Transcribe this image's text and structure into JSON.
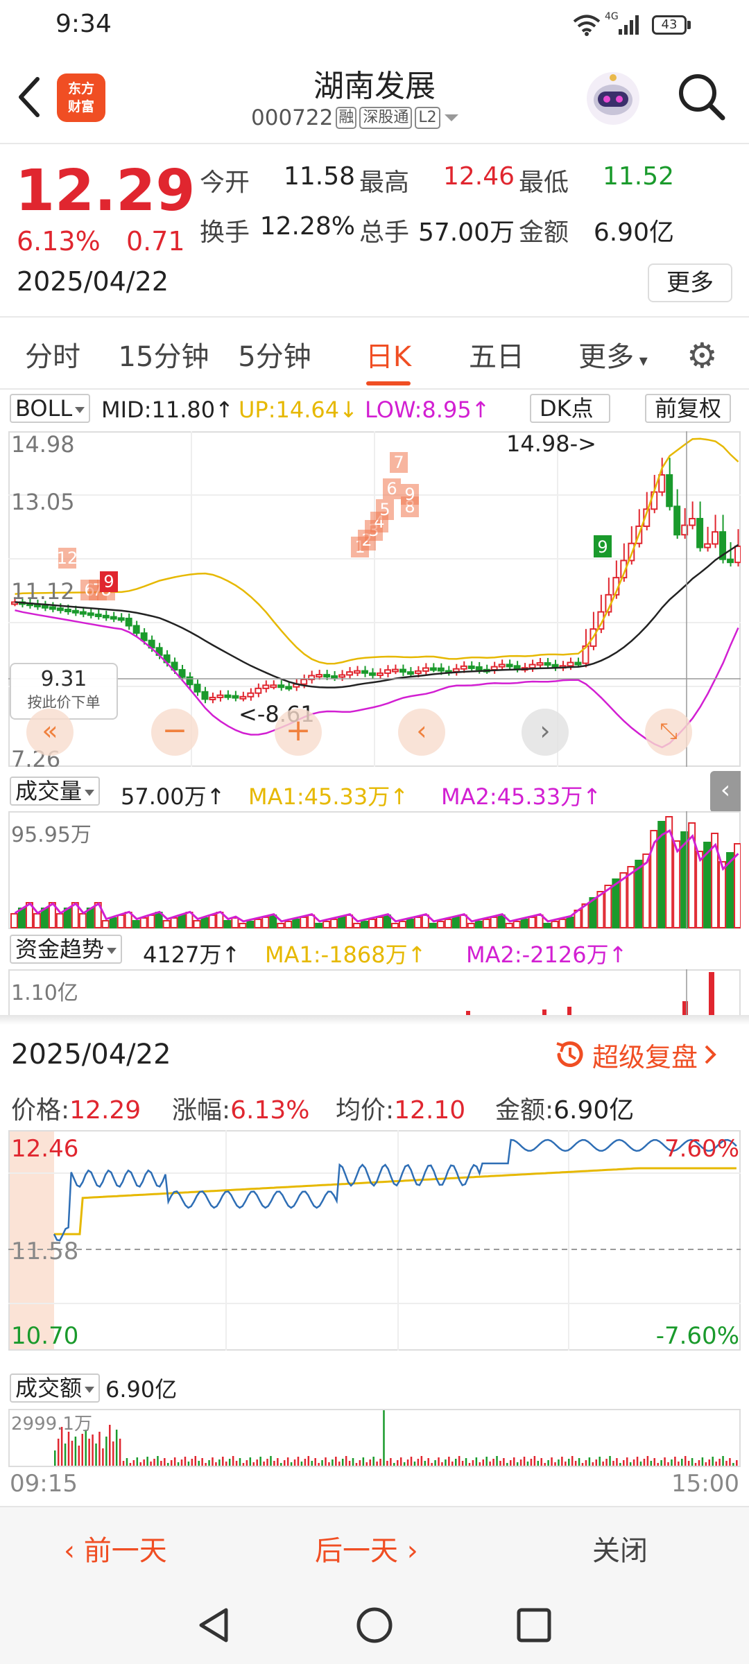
{
  "status": {
    "time": "9:34",
    "signal": "4G",
    "battery": "43"
  },
  "header": {
    "title": "湖南发展",
    "code": "000722",
    "badges": [
      "融",
      "深股通",
      "L2"
    ],
    "logo": [
      "东方",
      "财富"
    ]
  },
  "quote": {
    "price": "12.29",
    "pct": "6.13%",
    "chg": "0.71",
    "date": "2025/04/22",
    "stats": [
      {
        "label": "今开",
        "value": "11.58",
        "color": "#222"
      },
      {
        "label": "最高",
        "value": "12.46",
        "color": "#e0262f"
      },
      {
        "label": "最低",
        "value": "11.52",
        "color": "#1a9a2c"
      },
      {
        "label": "换手",
        "value": "12.28%",
        "color": "#222"
      },
      {
        "label": "总手",
        "value": "57.00万",
        "color": "#222"
      },
      {
        "label": "金额",
        "value": "6.90亿",
        "color": "#222"
      }
    ],
    "more": "更多"
  },
  "tabs": [
    "分时",
    "15分钟",
    "5分钟",
    "日K",
    "五日",
    "更多"
  ],
  "active_tab": "日K",
  "kchart": {
    "indicator": "BOLL",
    "mid": "MID:11.80↑",
    "up": "UP:14.64↓",
    "low": "LOW:8.95↑",
    "dk": "DK点",
    "fq": "前复权",
    "y_labels": [
      "14.98",
      "13.05",
      "11.12",
      "7.26"
    ],
    "max_note": "14.98->",
    "min_note": "<-8.61",
    "tip_price": "9.31",
    "tip_text": "按此价下单",
    "nine_labels": [
      "12",
      "6",
      "7",
      "8",
      "9",
      "1",
      "2",
      "3",
      "4",
      "5",
      "6",
      "7",
      "8",
      "9"
    ]
  },
  "volume": {
    "label": "成交量",
    "value": "57.00万↑",
    "ma1": "MA1:45.33万↑",
    "ma2": "MA2:45.33万↑",
    "ymax": "95.95万"
  },
  "capital": {
    "label": "资金趋势",
    "value": "4127万↑",
    "ma1": "MA1:-1868万↑",
    "ma2": "MA2:-2126万↑",
    "ymax": "1.10亿"
  },
  "review": {
    "date": "2025/04/22",
    "button": "超级复盘",
    "stats": [
      {
        "label": "价格:",
        "value": "12.29"
      },
      {
        "label": "涨幅:",
        "value": "6.13%"
      },
      {
        "label": "均价:",
        "value": "12.10"
      },
      {
        "label": "金额:",
        "value": "6.90亿"
      }
    ],
    "y_high": "12.46",
    "y_mid": "11.58",
    "y_low": "10.70",
    "pct_high": "7.60%",
    "pct_low": "-7.60%",
    "amount_label": "成交额",
    "amount_value": "6.90亿",
    "amount_max": "2999.1万",
    "t_start": "09:15",
    "t_end": "15:00"
  },
  "footer": {
    "prev": "前一天",
    "next": "后一天",
    "close": "关闭"
  },
  "colors": {
    "up": "#e0262f",
    "down": "#1a9a2c",
    "mid": "#222222",
    "upper": "#e6b800",
    "lower": "#d21fd2",
    "accent": "#f04e23"
  }
}
